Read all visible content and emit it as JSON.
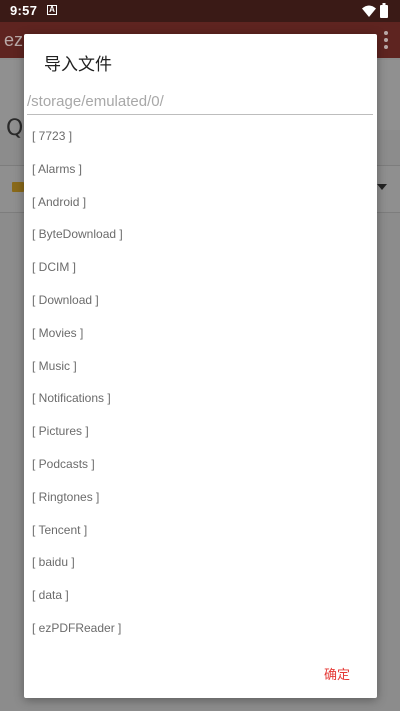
{
  "status_bar": {
    "time": "9:57",
    "notification_badge": "A",
    "icons": [
      "wifi-icon",
      "battery-icon"
    ]
  },
  "background_app": {
    "title": "ez",
    "search_glyph": "Q",
    "icons": [
      "overflow-menu-icon",
      "folder-icon",
      "dropdown-arrow-icon"
    ]
  },
  "dialog": {
    "title": "导入文件",
    "path": "/storage/emulated/0/",
    "items": [
      "[ 7723 ]",
      "[ Alarms ]",
      "[ Android ]",
      "[ ByteDownload ]",
      "[ DCIM ]",
      "[ Download ]",
      "[ Movies ]",
      "[ Music ]",
      "[ Notifications ]",
      "[ Pictures ]",
      "[ Podcasts ]",
      "[ Ringtones ]",
      "[ Tencent ]",
      "[ baidu ]",
      "[ data ]",
      "[ ezPDFReader ]"
    ],
    "confirm_label": "确定"
  },
  "colors": {
    "status_bar": "#3a1a16",
    "app_bar_dimmed": "#5e2420",
    "accent": "#e53935",
    "scrim": "#8c8c8c"
  }
}
